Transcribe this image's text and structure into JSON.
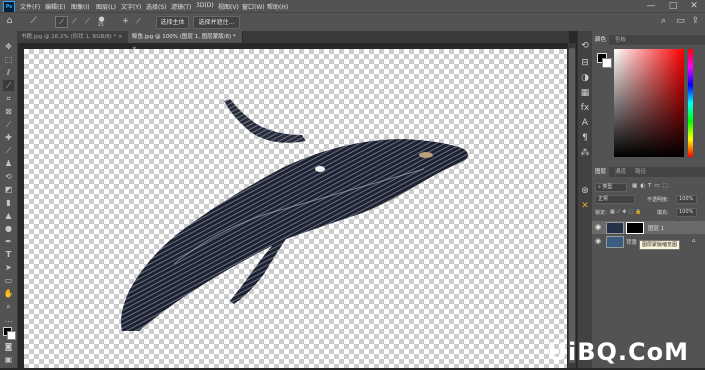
{
  "menubar": {
    "app_badge": "Ps",
    "items": [
      "文件(F)",
      "编辑(E)",
      "图像(I)",
      "图层(L)",
      "文字(Y)",
      "选择(S)",
      "滤镜(T)",
      "3D(D)",
      "视图(V)",
      "窗口(W)",
      "帮助(H)"
    ]
  },
  "options": {
    "select_subject": "选择主体",
    "select_and_mask": "选择并遮住...",
    "brush_size": "25"
  },
  "tabs": [
    {
      "label": "书籍.jpg @ 26.2% (形状 1, RGB/8) *",
      "close": "×",
      "active": false
    },
    {
      "label": "鲸鱼.jpg @ 100% (图层 1, 图层蒙版/8) *",
      "close": "×",
      "active": true
    }
  ],
  "color_panel": {
    "tabs": [
      "颜色",
      "色板"
    ]
  },
  "layers_panel": {
    "tabs": [
      "图层",
      "通道",
      "路径"
    ],
    "kind_label": "类型",
    "blend_mode": "正常",
    "opacity_label": "不透明度:",
    "opacity_value": "100%",
    "lock_label": "锁定:",
    "fill_label": "填充:",
    "fill_value": "100%",
    "layers": [
      {
        "name": "图层 1",
        "selected": true
      },
      {
        "name": "背景",
        "selected": false
      }
    ],
    "tooltip": "图层蒙版缩览图"
  },
  "watermark": "UiBQ.CoM",
  "colors": {
    "ui_bg": "#535353",
    "canvas_dark": "#282828",
    "hue_red": "#ff0000"
  }
}
